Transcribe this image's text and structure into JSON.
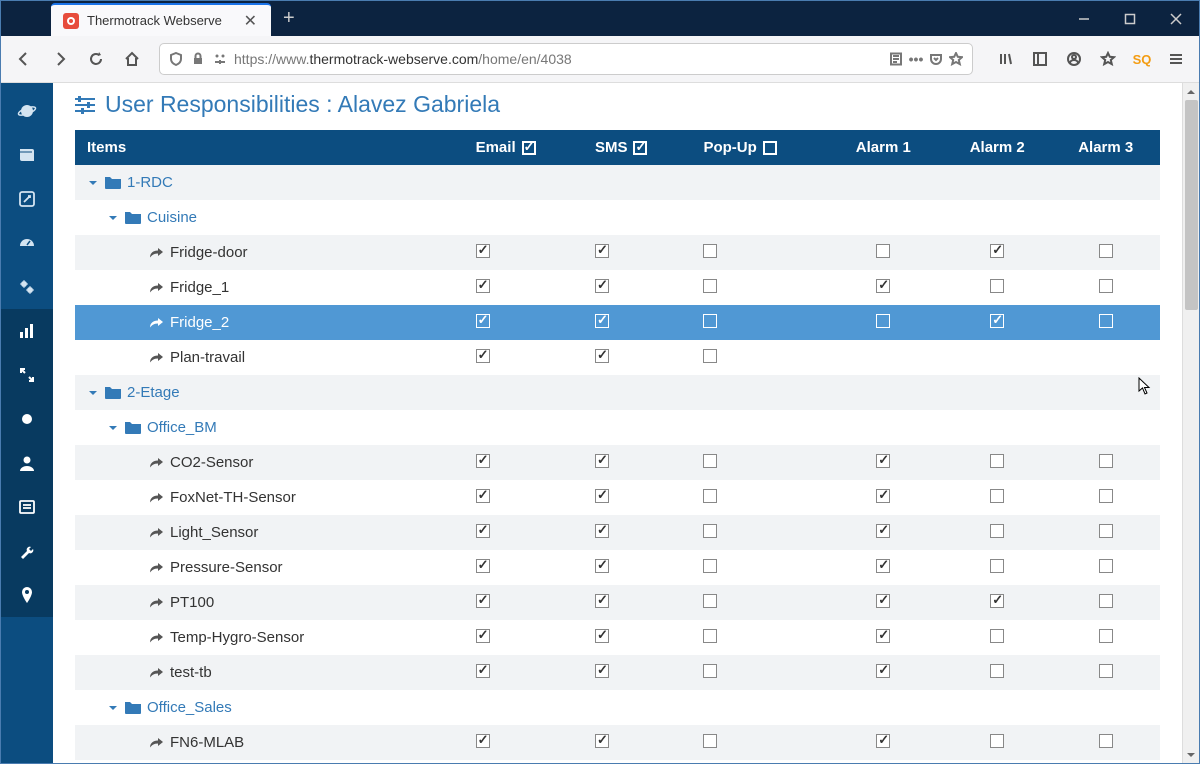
{
  "browser": {
    "tab_title": "Thermotrack Webserve",
    "url_prefix": "https://www.",
    "url_domain": "thermotrack-webserve.com",
    "url_path": "/home/en/4038"
  },
  "page": {
    "title": "User Responsibilities : Alavez Gabriela"
  },
  "headers": {
    "items": "Items",
    "email": "Email",
    "sms": "SMS",
    "popup": "Pop-Up",
    "alarm1": "Alarm 1",
    "alarm2": "Alarm 2",
    "alarm3": "Alarm 3",
    "email_checked": true,
    "sms_checked": true,
    "popup_checked": false
  },
  "rows": [
    {
      "type": "folder",
      "indent": 0,
      "label": "1-RDC",
      "selected": false
    },
    {
      "type": "folder",
      "indent": 1,
      "label": "Cuisine",
      "selected": false
    },
    {
      "type": "item",
      "indent": 2,
      "label": "Fridge-door",
      "selected": false,
      "email": true,
      "sms": true,
      "popup": false,
      "alarm1": false,
      "alarm2": true,
      "alarm3": false
    },
    {
      "type": "item",
      "indent": 2,
      "label": "Fridge_1",
      "selected": false,
      "email": true,
      "sms": true,
      "popup": false,
      "alarm1": true,
      "alarm2": false,
      "alarm3": false
    },
    {
      "type": "item",
      "indent": 2,
      "label": "Fridge_2",
      "selected": true,
      "email": true,
      "sms": true,
      "popup": false,
      "alarm1": false,
      "alarm2": true,
      "alarm3": false
    },
    {
      "type": "item",
      "indent": 2,
      "label": "Plan-travail",
      "selected": false,
      "email": true,
      "sms": true,
      "popup": false
    },
    {
      "type": "folder",
      "indent": 0,
      "label": "2-Etage",
      "selected": false
    },
    {
      "type": "folder",
      "indent": 1,
      "label": "Office_BM",
      "selected": false
    },
    {
      "type": "item",
      "indent": 2,
      "label": "CO2-Sensor",
      "selected": false,
      "email": true,
      "sms": true,
      "popup": false,
      "alarm1": true,
      "alarm2": false,
      "alarm3": false
    },
    {
      "type": "item",
      "indent": 2,
      "label": "FoxNet-TH-Sensor",
      "selected": false,
      "email": true,
      "sms": true,
      "popup": false,
      "alarm1": true,
      "alarm2": false,
      "alarm3": false
    },
    {
      "type": "item",
      "indent": 2,
      "label": "Light_Sensor",
      "selected": false,
      "email": true,
      "sms": true,
      "popup": false,
      "alarm1": true,
      "alarm2": false,
      "alarm3": false
    },
    {
      "type": "item",
      "indent": 2,
      "label": "Pressure-Sensor",
      "selected": false,
      "email": true,
      "sms": true,
      "popup": false,
      "alarm1": true,
      "alarm2": false,
      "alarm3": false
    },
    {
      "type": "item",
      "indent": 2,
      "label": "PT100",
      "selected": false,
      "email": true,
      "sms": true,
      "popup": false,
      "alarm1": true,
      "alarm2": true,
      "alarm3": false
    },
    {
      "type": "item",
      "indent": 2,
      "label": "Temp-Hygro-Sensor",
      "selected": false,
      "email": true,
      "sms": true,
      "popup": false,
      "alarm1": true,
      "alarm2": false,
      "alarm3": false
    },
    {
      "type": "item",
      "indent": 2,
      "label": "test-tb",
      "selected": false,
      "email": true,
      "sms": true,
      "popup": false,
      "alarm1": true,
      "alarm2": false,
      "alarm3": false
    },
    {
      "type": "folder",
      "indent": 1,
      "label": "Office_Sales",
      "selected": false
    },
    {
      "type": "item",
      "indent": 2,
      "label": "FN6-MLAB",
      "selected": false,
      "email": true,
      "sms": true,
      "popup": false,
      "alarm1": true,
      "alarm2": false,
      "alarm3": false
    }
  ]
}
